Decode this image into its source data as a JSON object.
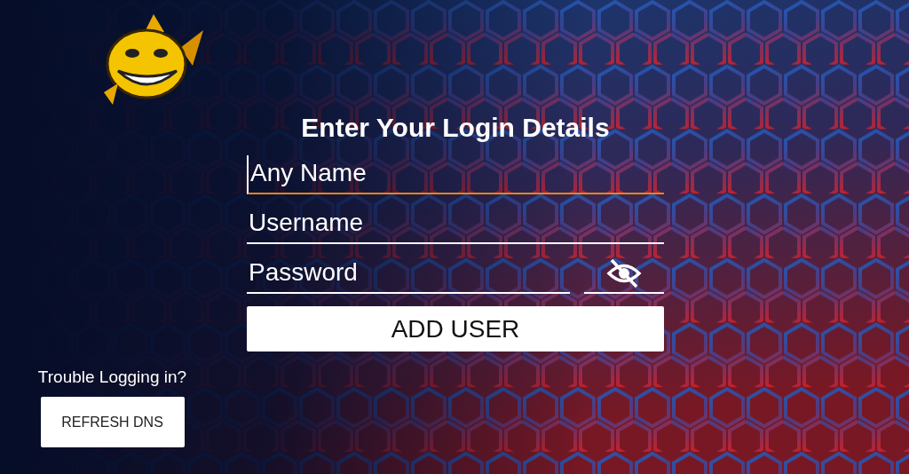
{
  "title": "Enter Your Login Details",
  "fields": [
    {
      "kind": "text",
      "placeholder": "Any Name",
      "focused": true
    },
    {
      "kind": "text",
      "placeholder": "Username",
      "focused": false
    },
    {
      "kind": "password",
      "placeholder": "Password",
      "focused": false
    }
  ],
  "password_visible": false,
  "add_button": "ADD USER",
  "help_text": "Trouble Logging in?",
  "refresh_button": "REFRESH DNS"
}
